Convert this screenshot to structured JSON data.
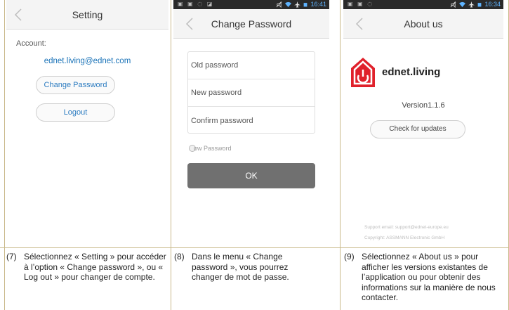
{
  "panel1": {
    "title": "Setting",
    "account_label": "Account:",
    "email": "ednet.living@ednet.com",
    "change_password_label": "Change Password",
    "logout_label": "Logout"
  },
  "panel2": {
    "status_time": "16:41",
    "title": "Change Password",
    "old_password_placeholder": "Old password",
    "new_password_placeholder": "New password",
    "confirm_password_placeholder": "Confirm password",
    "show_password_label": "ow Password",
    "ok_label": "OK"
  },
  "panel3": {
    "status_time": "16:34",
    "title": "About us",
    "brand": "ednet.living",
    "version": "Version1.1.6",
    "check_updates_label": "Check for updates",
    "support_email": "Support email: support@ednet-europe.eu",
    "copyright": "Copyright: ASSMANN Electronic GmbH",
    "logo_color": "#e0212b"
  },
  "captions": [
    {
      "number": "(7)",
      "text": "Sélectionnez « Setting » pour accéder à l’option « Change password », ou « Log out » pour changer de compte."
    },
    {
      "number": "(8)",
      "text": "Dans le menu « Change password », vous pourrez changer de mot de passe."
    },
    {
      "number": "(9)",
      "text": "Sélectionnez « About us » pour afficher les versions existantes de l’application ou pour obtenir des informations sur la manière de nous contacter."
    }
  ]
}
